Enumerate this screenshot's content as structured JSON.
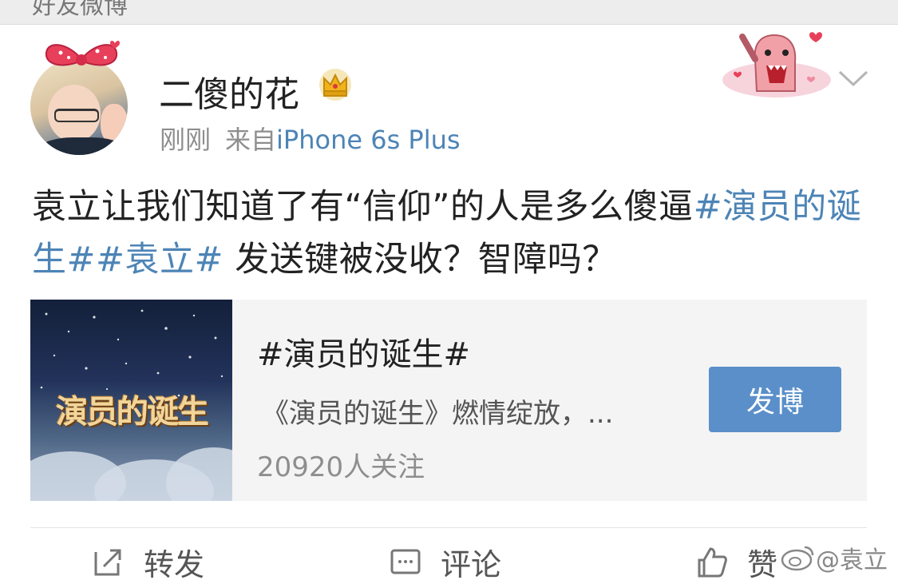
{
  "topbar": {
    "title": "好友微博"
  },
  "post": {
    "username": "二傻的花",
    "time": "刚刚",
    "source_prefix": "来自",
    "device": "iPhone 6s Plus",
    "text_plain_1": "袁立让我们知道了有“信仰”的人是多么傻逼",
    "tag_1": "#演员的诞生#",
    "tag_2": "#袁立#",
    "text_plain_2": " 发送键被没收？智障吗？"
  },
  "card": {
    "title": "#演员的诞生#",
    "description": "《演员的诞生》燃情绽放，...",
    "followers": "20920人关注",
    "button_label": "发博",
    "thumb_logo": "演员的诞生"
  },
  "actions": {
    "repost_label": "转发",
    "comment_label": "评论",
    "like_label": "赞"
  },
  "watermark": {
    "text": "@袁立"
  },
  "icons": {
    "crown": "crown-icon",
    "chevron": "chevron-down-icon",
    "repost": "repost-icon",
    "comment": "comment-icon",
    "like": "thumbs-up-icon",
    "weibo": "weibo-logo-icon"
  },
  "colors": {
    "link": "#4d84b6",
    "button": "#5a8fc9",
    "meta": "#8e8e8e"
  }
}
